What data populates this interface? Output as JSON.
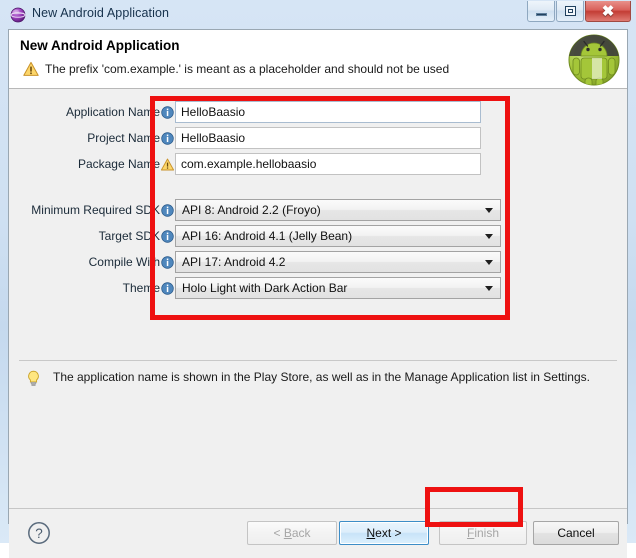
{
  "window": {
    "title": "New Android Application",
    "icon": "globe-icon",
    "controls": {
      "minimize": "minimize-icon",
      "maximize": "maximize-icon",
      "close": "close-icon"
    }
  },
  "header": {
    "title": "New Android Application",
    "message": "The prefix 'com.example.' is meant as a placeholder and should not be used",
    "message_icon": "warning-icon",
    "logo": "android-robot-logo"
  },
  "form": {
    "fields": [
      {
        "label": "Application Name",
        "icon": "info-icon",
        "type": "text",
        "value": "HelloBaasio",
        "placeholder": "",
        "focused": true
      },
      {
        "label": "Project Name",
        "icon": "info-icon",
        "type": "text",
        "value": "HelloBaasio",
        "placeholder": "",
        "focused": false
      },
      {
        "label": "Package Name",
        "icon": "warning-icon",
        "type": "text",
        "value": "com.example.hellobaasio",
        "placeholder": "",
        "focused": false
      },
      {
        "label": "Minimum Required SDK",
        "icon": "info-icon",
        "type": "combo",
        "value": "API 8: Android 2.2 (Froyo)"
      },
      {
        "label": "Target SDK",
        "icon": "info-icon",
        "type": "combo",
        "value": "API 16: Android 4.1 (Jelly Bean)"
      },
      {
        "label": "Compile With",
        "icon": "info-icon",
        "type": "combo",
        "value": "API 17: Android 4.2"
      },
      {
        "label": "Theme",
        "icon": "info-icon",
        "type": "combo",
        "value": "Holo Light with Dark Action Bar"
      }
    ]
  },
  "hint": {
    "icon": "lightbulb-icon",
    "text": "The application name is shown in the Play Store, as well as in the Manage Application list in Settings."
  },
  "footer": {
    "help_icon": "question-mark-icon",
    "buttons": {
      "back": "< Back",
      "back_pre": "< ",
      "back_mnemonic": "B",
      "back_post": "ack",
      "next_pre": "",
      "next_mnemonic": "N",
      "next_post": "ext >",
      "finish_pre": "",
      "finish_mnemonic": "F",
      "finish_post": "inish",
      "cancel": "Cancel"
    }
  },
  "annotations": {
    "highlight_color": "#ee1111",
    "boxes": [
      {
        "name": "fields-highlight"
      },
      {
        "name": "finish-button-highlight"
      }
    ]
  }
}
